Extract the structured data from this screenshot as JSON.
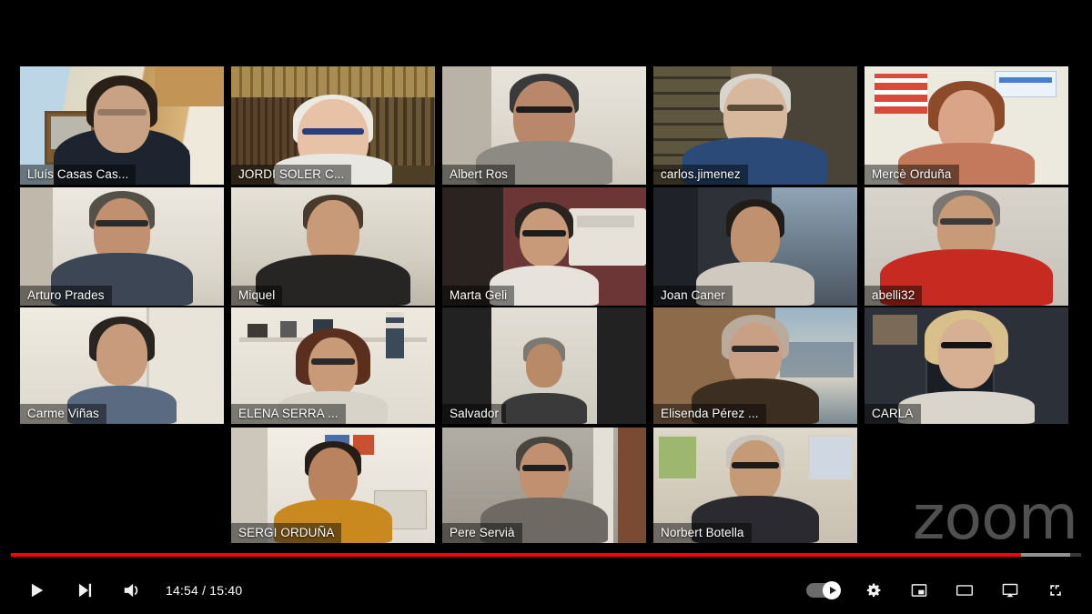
{
  "app": {
    "platform": "YouTube video player",
    "content": "Zoom meeting gallery view recording",
    "watermark": "zoom"
  },
  "player": {
    "time_display": "14:54 / 15:40",
    "current_time": "14:54",
    "duration": "15:40",
    "progress_percent": 94.4,
    "loaded_percent": 99,
    "accent_color": "#ff0000",
    "controls_left": [
      {
        "name": "play-button",
        "label": "Play",
        "icon": "play-icon"
      },
      {
        "name": "next-button",
        "label": "Next video",
        "icon": "next-icon"
      },
      {
        "name": "volume-button",
        "label": "Mute",
        "icon": "volume-icon"
      }
    ],
    "controls_right": [
      {
        "name": "autoplay-toggle",
        "label": "Autoplay is on",
        "icon": "toggle-on-icon"
      },
      {
        "name": "settings-button",
        "label": "Settings",
        "icon": "gear-icon"
      },
      {
        "name": "miniplayer-button",
        "label": "Miniplayer",
        "icon": "miniplayer-icon"
      },
      {
        "name": "theater-button",
        "label": "Theater mode",
        "icon": "theater-icon"
      },
      {
        "name": "cast-button",
        "label": "Play on TV",
        "icon": "cast-icon"
      },
      {
        "name": "fullscreen-button",
        "label": "Full screen",
        "icon": "fullscreen-icon"
      }
    ]
  },
  "meeting": {
    "active_speaker_border_color": "#55dd11",
    "rows": [
      {
        "tiles": [
          {
            "name": "Lluís Casas Cas...",
            "bg": "#cfc2a6",
            "wall": "#e8e2d4",
            "skin": "#c9a184",
            "hair": "#2b2018",
            "shirt": "#1d2430",
            "glasses": false,
            "accent": "#7b5a34",
            "scene": "kitchen"
          },
          {
            "name": "JORDI SOLER C...",
            "bg": "#6b5533",
            "wall": "#8a6f42",
            "skin": "#e8c2a6",
            "hair": "#e8e4df",
            "shirt": "#e9e7e2",
            "glasses": true,
            "accent": "#4a3a22",
            "scene": "bookshelf",
            "active": true
          },
          {
            "name": "Albert Ros",
            "bg": "#d9d5cd",
            "wall": "#e6e2da",
            "skin": "#b9886a",
            "hair": "#3a3a3a",
            "shirt": "#8d8a84",
            "glasses": true,
            "accent": "#c4bfb5",
            "scene": "room"
          },
          {
            "name": "carlos.jimenez",
            "bg": "#4a4438",
            "wall": "#5d5647",
            "skin": "#d8b89c",
            "hair": "#d8d4cf",
            "shirt": "#2b4a78",
            "glasses": true,
            "accent": "#2d2a24",
            "scene": "bookshelf"
          },
          {
            "name": "Mercè Orduña",
            "bg": "#e4ded2",
            "wall": "#efeae0",
            "skin": "#d9a487",
            "hair": "#8d4a2a",
            "shirt": "#c4795c",
            "glasses": false,
            "accent": "#d24a3a",
            "scene": "office"
          }
        ]
      },
      {
        "tiles": [
          {
            "name": "Arturo Prades",
            "bg": "#ddd8ce",
            "wall": "#e9e5dc",
            "skin": "#c09070",
            "hair": "#555048",
            "shirt": "#3d4654",
            "glasses": true,
            "accent": "#bdb6a8",
            "scene": "room"
          },
          {
            "name": "Miquel",
            "bg": "#d7d2c6",
            "wall": "#e2ddd1",
            "skin": "#c99a78",
            "hair": "#4a3a2c",
            "shirt": "#262523",
            "glasses": false,
            "accent": "#b8b1a2",
            "scene": "room"
          },
          {
            "name": "Marta Geli",
            "bg": "#7a3d3d",
            "wall": "#8a4848",
            "skin": "#c99a7a",
            "hair": "#2a2420",
            "shirt": "#e7e3dc",
            "glasses": true,
            "accent": "#d7d2c8",
            "scene": "office"
          },
          {
            "name": "Joan Caner",
            "bg": "#2e3138",
            "wall": "#3c4049",
            "skin": "#c0916e",
            "hair": "#221c18",
            "shirt": "#d9d4cc",
            "glasses": false,
            "accent": "#57606c",
            "scene": "car"
          },
          {
            "name": "abelli32",
            "bg": "#c8c4bc",
            "wall": "#d6d2c9",
            "skin": "#c79a78",
            "hair": "#7b7671",
            "shirt": "#c62a20",
            "glasses": true,
            "accent": "#b0aba1",
            "scene": "room"
          }
        ]
      },
      {
        "tiles": [
          {
            "name": "Carme Viñas",
            "bg": "#dedacf",
            "wall": "#eae6dc",
            "skin": "#c79b7c",
            "hair": "#2a2420",
            "shirt": "#5a6a80",
            "glasses": false,
            "accent": "#c2bcae",
            "scene": "room"
          },
          {
            "name": "ELENA SERRA ...",
            "bg": "#e3ded3",
            "wall": "#eee9df",
            "skin": "#c89a78",
            "hair": "#5a2f1e",
            "shirt": "#d8d3c9",
            "glasses": true,
            "accent": "#4a4a52",
            "scene": "shelf"
          },
          {
            "name": "Salvador",
            "bg": "#2a2a2a",
            "wall": "#d9d5cc",
            "skin": "#b98a68",
            "hair": "#7d7872",
            "shirt": "#3a3a3a",
            "glasses": false,
            "accent": "#1d1d1d",
            "scene": "letterbox"
          },
          {
            "name": "Elisenda Pérez ...",
            "bg": "#8d6b4a",
            "wall": "#9b7853",
            "skin": "#caa084",
            "hair": "#b9aa9c",
            "shirt": "#3d2e22",
            "glasses": true,
            "accent": "#7a92a8",
            "scene": "picture"
          },
          {
            "name": "CARLA",
            "bg": "#2c3038",
            "wall": "#3a3e46",
            "skin": "#d7b094",
            "hair": "#d9c08a",
            "shirt": "#d9d5cd",
            "glasses": true,
            "accent": "#1e2228",
            "scene": "room"
          }
        ]
      },
      {
        "tiles": [
          {
            "name": "SERGI ORDUÑA",
            "bg": "#e3dfd6",
            "wall": "#eeeae2",
            "skin": "#b9835f",
            "hair": "#241d18",
            "shirt": "#c9891f",
            "glasses": false,
            "accent": "#cdc7bb",
            "scene": "office"
          },
          {
            "name": "Pere Servià",
            "bg": "#a8a29a",
            "wall": "#b5b0a7",
            "skin": "#c09070",
            "hair": "#4a443e",
            "shirt": "#6e6a63",
            "glasses": true,
            "accent": "#8f8a82",
            "scene": "room"
          },
          {
            "name": "Norbert Botella",
            "bg": "#cfc6b6",
            "wall": "#ded6c8",
            "skin": "#c59a76",
            "hair": "#c9c4bd",
            "shirt": "#2b2a30",
            "glasses": true,
            "accent": "#7e9c5e",
            "scene": "picture"
          }
        ]
      }
    ]
  }
}
